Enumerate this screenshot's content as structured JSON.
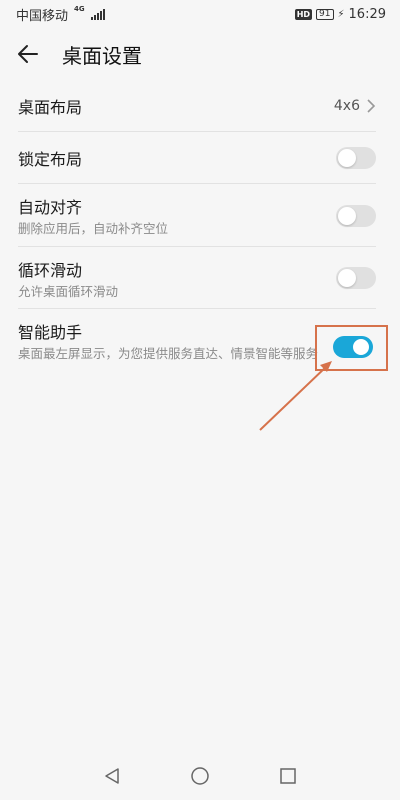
{
  "status_bar": {
    "carrier": "中国移动",
    "network": "4G",
    "hd": "HD",
    "battery": "91",
    "time": "16:29"
  },
  "header": {
    "title": "桌面设置"
  },
  "settings": {
    "layout": {
      "title": "桌面布局",
      "value": "4x6"
    },
    "lock_layout": {
      "title": "锁定布局",
      "enabled": false
    },
    "auto_align": {
      "title": "自动对齐",
      "subtitle": "删除应用后，自动补齐空位",
      "enabled": false
    },
    "loop_scroll": {
      "title": "循环滑动",
      "subtitle": "允许桌面循环滑动",
      "enabled": false
    },
    "smart_assistant": {
      "title": "智能助手",
      "subtitle": "桌面最左屏显示，为您提供服务直达、情景智能等服务",
      "enabled": true
    }
  },
  "icons": {
    "back": "arrow-left-icon",
    "chevron": "chevron-right-icon",
    "nav_back": "triangle-back-icon",
    "nav_home": "circle-home-icon",
    "nav_recent": "square-recent-icon"
  },
  "colors": {
    "accent": "#1aa7d8",
    "annotation": "#d6724b",
    "background": "#f6f6f6"
  }
}
